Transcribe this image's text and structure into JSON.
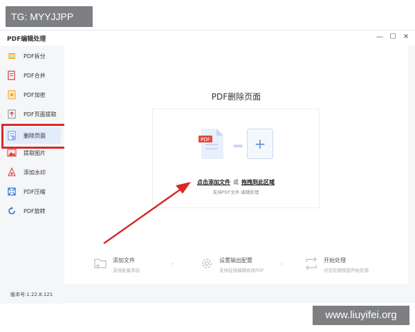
{
  "watermark_top": "TG: MYYJJPP",
  "watermark_bottom": "www.liuyifei.org",
  "window": {
    "title": "PDF编辑处理",
    "minimize_glyph": "—",
    "maximize_glyph": "☐",
    "close_glyph": "✕"
  },
  "sidebar": {
    "items": [
      {
        "label": "PDF拆分",
        "icon": "split-icon"
      },
      {
        "label": "PDF合并",
        "icon": "merge-icon"
      },
      {
        "label": "PDF加密",
        "icon": "encrypt-icon"
      },
      {
        "label": "PDF页面提取",
        "icon": "extract-page-icon"
      },
      {
        "label": "删除页面",
        "icon": "delete-page-icon",
        "active": true
      },
      {
        "label": "提取图片",
        "icon": "extract-image-icon"
      },
      {
        "label": "添加水印",
        "icon": "watermark-icon"
      },
      {
        "label": "PDF压缩",
        "icon": "compress-icon"
      },
      {
        "label": "PDF旋转",
        "icon": "rotate-icon"
      }
    ],
    "version": "版本号:1.22.8.121"
  },
  "main": {
    "title": "PDF删除页面",
    "drop": {
      "file_badge": "PDF",
      "plus_glyph": "+",
      "click_add": "点击添加文件",
      "or": "或",
      "drag_here": "拖拽到此区域",
      "hint": "支持PDF文件 编辑处理"
    },
    "steps": [
      {
        "title": "添加文件",
        "desc": "支持批量添加"
      },
      {
        "title": "设置输出配置",
        "desc": "支持在线编辑修改PDF"
      },
      {
        "title": "开始处理",
        "desc": "点击处理按钮开始处理"
      }
    ],
    "step_arrow": "›"
  },
  "colors": {
    "accent": "#5a8fd8",
    "highlight": "#d92828",
    "active_bg": "#e3ecfa"
  }
}
